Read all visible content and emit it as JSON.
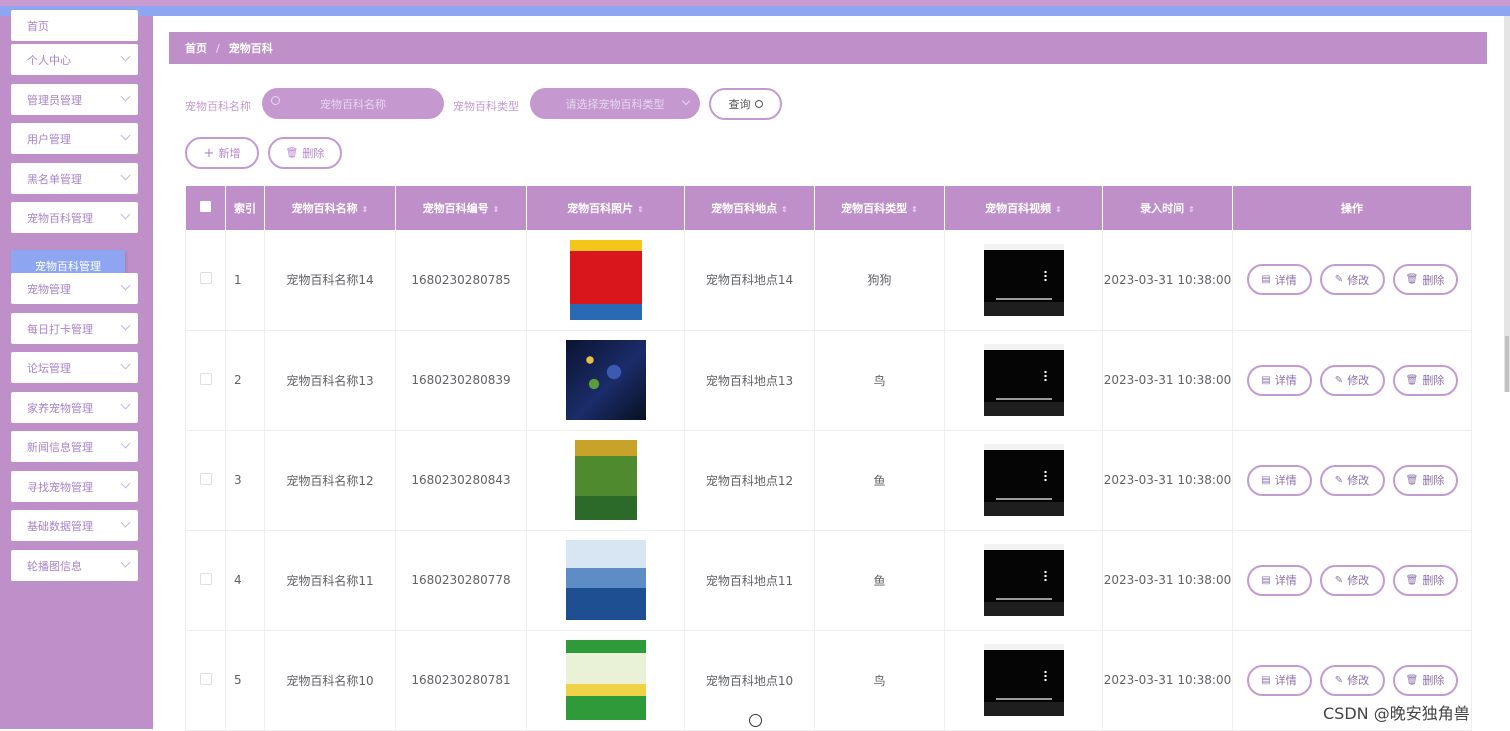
{
  "colors": {
    "accent": "#bf8fca",
    "active": "#8ea6f2",
    "topbar": "#8ea6f2"
  },
  "sidebar": {
    "items": [
      {
        "label": "首页"
      },
      {
        "label": "个人中心"
      },
      {
        "label": "管理员管理"
      },
      {
        "label": "用户管理"
      },
      {
        "label": "黑名单管理"
      },
      {
        "label": "宠物百科管理"
      },
      {
        "label": "宠物管理"
      },
      {
        "label": "每日打卡管理"
      },
      {
        "label": "论坛管理"
      },
      {
        "label": "家养宠物管理"
      },
      {
        "label": "新闻信息管理"
      },
      {
        "label": "寻找宠物管理"
      },
      {
        "label": "基础数据管理"
      },
      {
        "label": "轮播图信息"
      }
    ],
    "submenu_label": "宠物百科管理"
  },
  "breadcrumb": {
    "home": "首页",
    "separator": "/",
    "current": "宠物百科"
  },
  "search": {
    "name_label": "宠物百科名称",
    "name_placeholder": "宠物百科名称",
    "type_label": "宠物百科类型",
    "type_placeholder": "请选择宠物百科类型",
    "query_button": "查询"
  },
  "toolbar": {
    "add_label": "新增",
    "delete_label": "删除"
  },
  "table": {
    "headers": [
      "索引",
      "宠物百科名称",
      "宠物百科编号",
      "宠物百科照片",
      "宠物百科地点",
      "宠物百科类型",
      "宠物百科视频",
      "录入时间",
      "操作"
    ],
    "rows": [
      {
        "index": "1",
        "name": "宠物百科名称14",
        "code": "1680230280785",
        "photo": "encyclopedia-cover-red",
        "place": "宠物百科地点14",
        "type": "狗狗",
        "time": "2023-03-31 10:38:00"
      },
      {
        "index": "2",
        "name": "宠物百科名称13",
        "code": "1680230280839",
        "photo": "space-planets",
        "place": "宠物百科地点13",
        "type": "鸟",
        "time": "2023-03-31 10:38:00"
      },
      {
        "index": "3",
        "name": "宠物百科名称12",
        "code": "1680230280843",
        "photo": "animal-world-book",
        "place": "宠物百科地点12",
        "type": "鱼",
        "time": "2023-03-31 10:38:00"
      },
      {
        "index": "4",
        "name": "宠物百科名称11",
        "code": "1680230280778",
        "photo": "ocean-whale",
        "place": "宠物百科地点11",
        "type": "鱼",
        "time": "2023-03-31 10:38:00"
      },
      {
        "index": "5",
        "name": "宠物百科名称10",
        "code": "1680230280781",
        "photo": "kids-encyclopedia-green",
        "place": "宠物百科地点10",
        "type": "鸟",
        "time": "2023-03-31 10:38:00"
      }
    ],
    "actions": {
      "detail": "详情",
      "edit": "修改",
      "delete": "删除"
    }
  },
  "watermark": "CSDN @晚安独角兽"
}
